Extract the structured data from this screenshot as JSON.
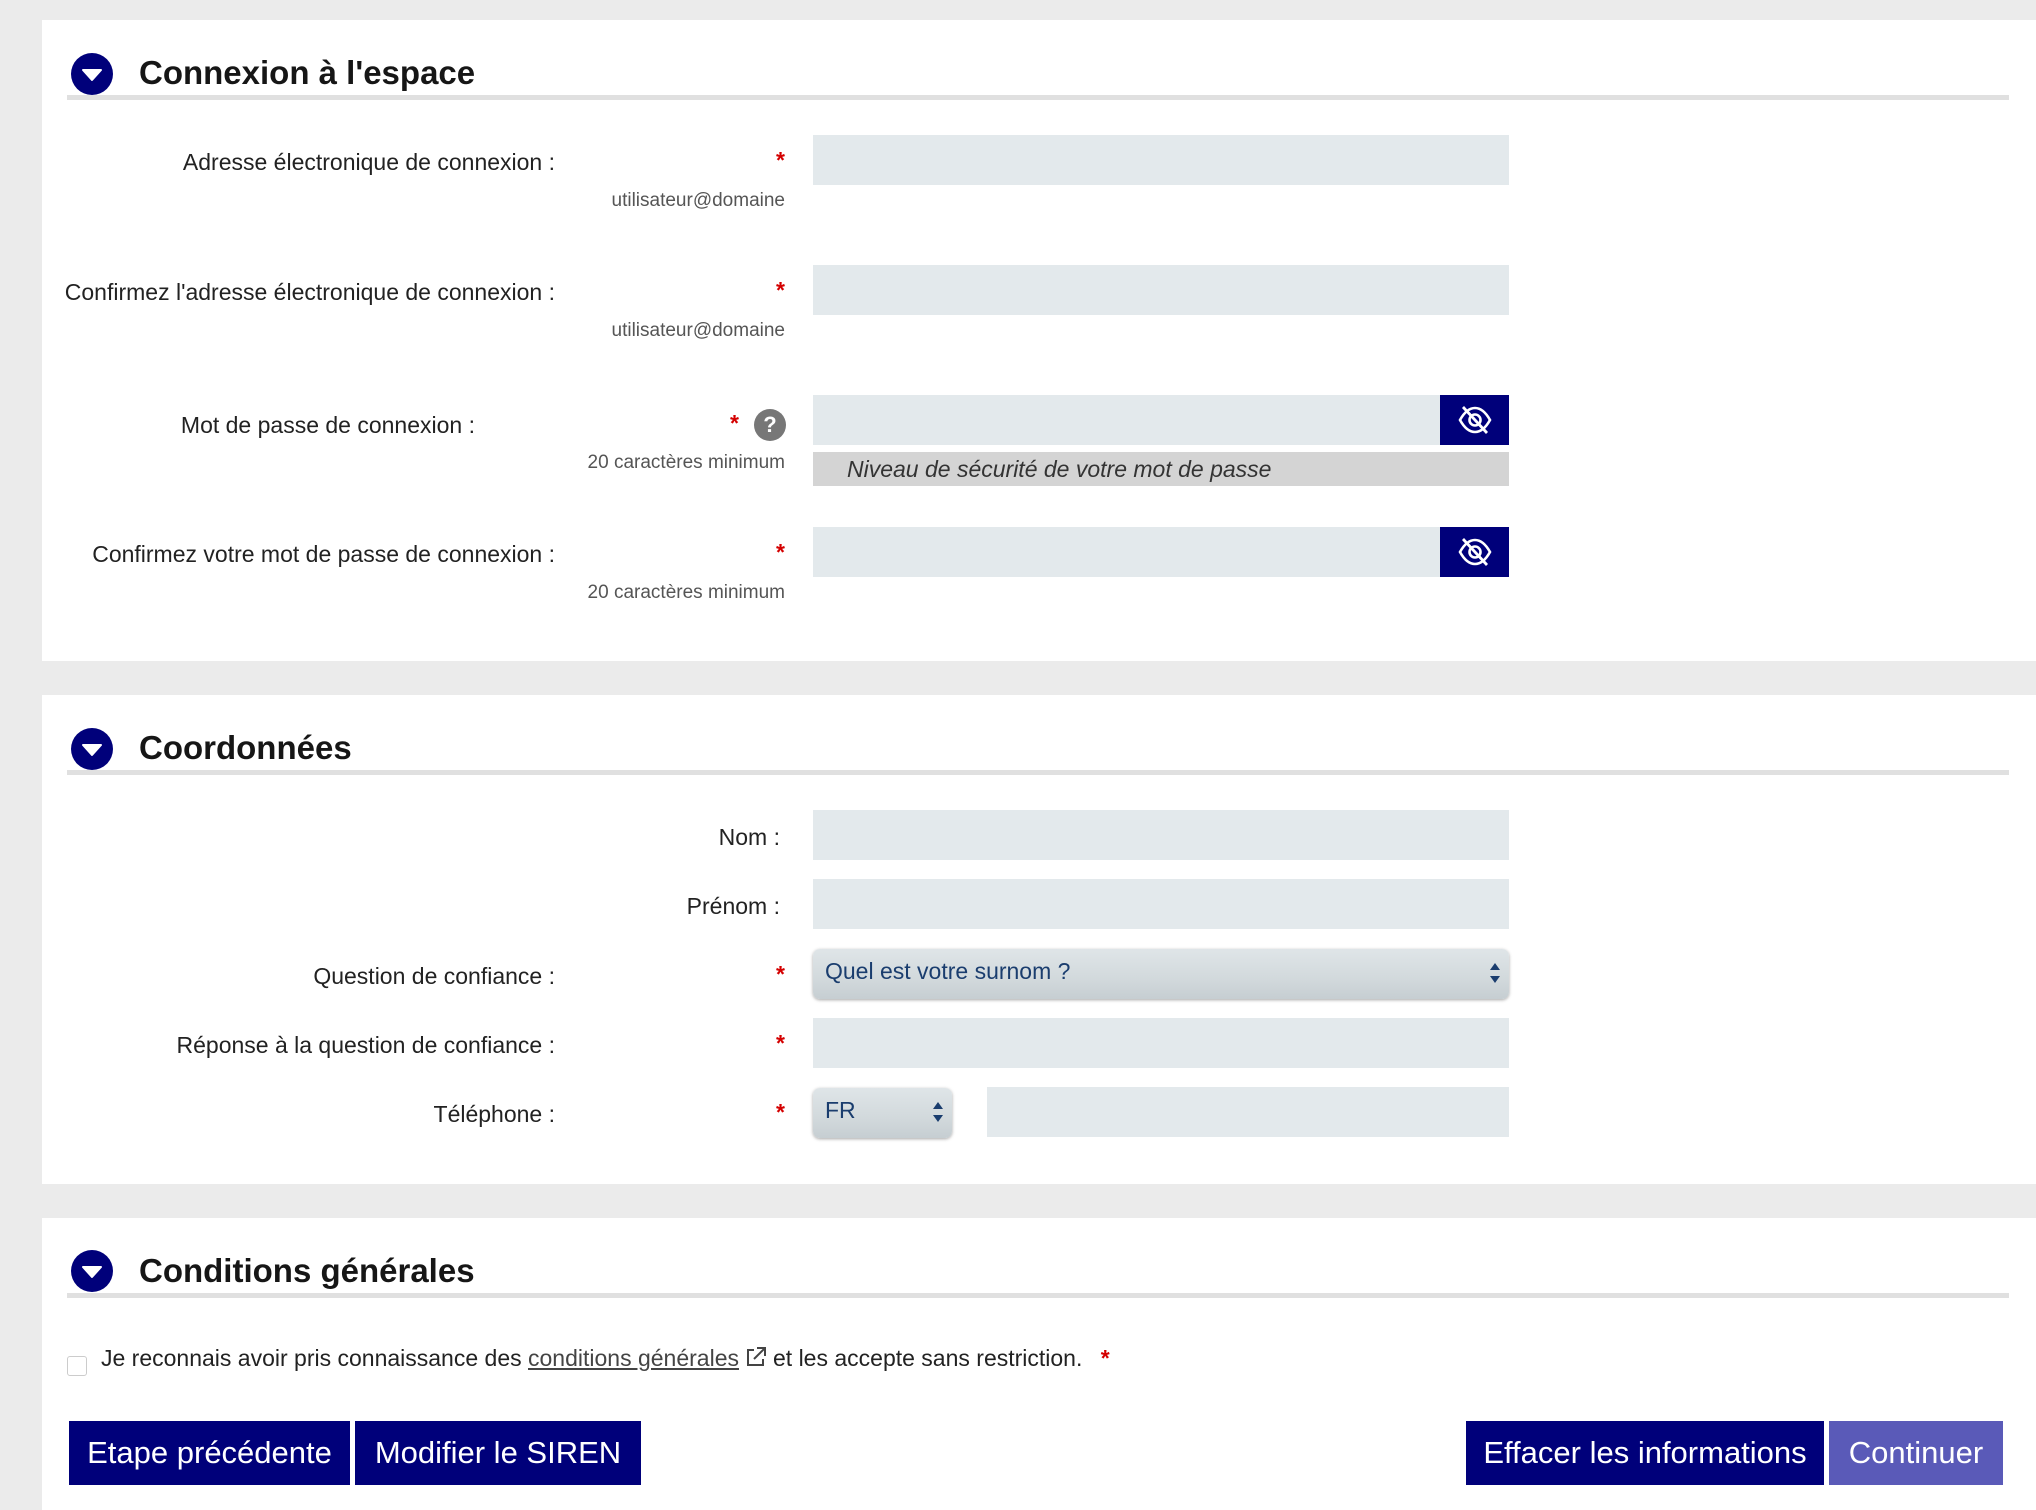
{
  "sections": {
    "connexion": {
      "title": "Connexion à l'espace",
      "email_label": "Adresse électronique de connexion :",
      "email_hint": "utilisateur@domaine",
      "email_value": "",
      "confirm_email_label": "Confirmez l'adresse électronique de connexion :",
      "confirm_email_hint": "utilisateur@domaine",
      "confirm_email_value": "",
      "password_label": "Mot de passe de connexion :",
      "password_hint": "20 caractères minimum",
      "password_help": "?",
      "password_strength": "Niveau de sécurité de votre mot de passe",
      "confirm_password_label": "Confirmez votre mot de passe de connexion :",
      "confirm_password_hint": "20 caractères minimum"
    },
    "coordonnees": {
      "title": "Coordonnées",
      "nom_label": "Nom :",
      "prenom_label": "Prénom :",
      "question_label": "Question de confiance :",
      "question_selected": "Quel est votre surnom ?",
      "reponse_label": "Réponse à la question de confiance :",
      "telephone_label": "Téléphone :",
      "country_selected": "FR"
    },
    "conditions": {
      "title": "Conditions générales",
      "text_before": "Je reconnais avoir pris connaissance des",
      "link_text": "conditions générales",
      "text_after": "et les accepte sans restriction.",
      "accepted": false
    }
  },
  "required_marker": "*",
  "buttons": {
    "previous": "Etape précédente",
    "modify_siren": "Modifier le SIREN",
    "clear": "Effacer les informations",
    "continue": "Continuer"
  },
  "colors": {
    "primary": "#00007a",
    "continue_button": "#5a5ab8",
    "required": "#d40000",
    "field_bg": "#e3e9ec",
    "page_bg": "#ebebeb"
  },
  "icons": {
    "section": "chevron-down-icon",
    "password_toggle": "eye-off-icon",
    "help": "question-icon",
    "external_link": "external-link-icon"
  }
}
